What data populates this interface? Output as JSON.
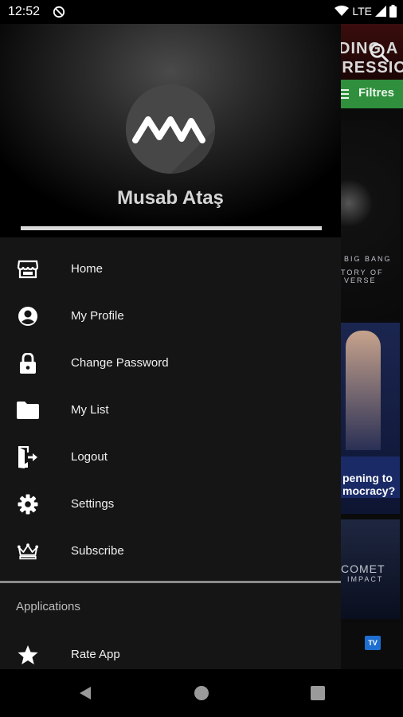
{
  "status_bar": {
    "time": "12:52",
    "network": "LTE",
    "sync_icon": "sync-disabled-icon",
    "wifi_icon": "wifi-icon",
    "signal_icon": "signal-icon",
    "battery_icon": "battery-icon"
  },
  "background_app": {
    "filter_label": "Filtres",
    "tv_badge": "TV",
    "poster_title_fragment": "DING A PRESSION",
    "tile_1_text": "BIG BANG\nTORY OF\nVERSE",
    "tile_2_overlay": "pening to\nmocracy?",
    "tile_3_text": "COMET\nIMPACT"
  },
  "drawer": {
    "user_name": "Musab Ataş",
    "avatar_monogram": "MA",
    "menu": [
      {
        "label": "Home",
        "icon": "store-icon"
      },
      {
        "label": "My Profile",
        "icon": "account-circle-icon"
      },
      {
        "label": "Change Password",
        "icon": "lock-icon"
      },
      {
        "label": "My List",
        "icon": "folder-icon"
      },
      {
        "label": "Logout",
        "icon": "exit-door-icon"
      },
      {
        "label": "Settings",
        "icon": "gear-icon"
      },
      {
        "label": "Subscribe",
        "icon": "crown-icon"
      }
    ],
    "applications_title": "Applications",
    "rate_app": {
      "label": "Rate App",
      "icon": "star-icon"
    }
  },
  "colors": {
    "drawer_bg": "#151515",
    "filter_green": "#2f8f3d",
    "accent_blue": "#1e6fd1"
  }
}
